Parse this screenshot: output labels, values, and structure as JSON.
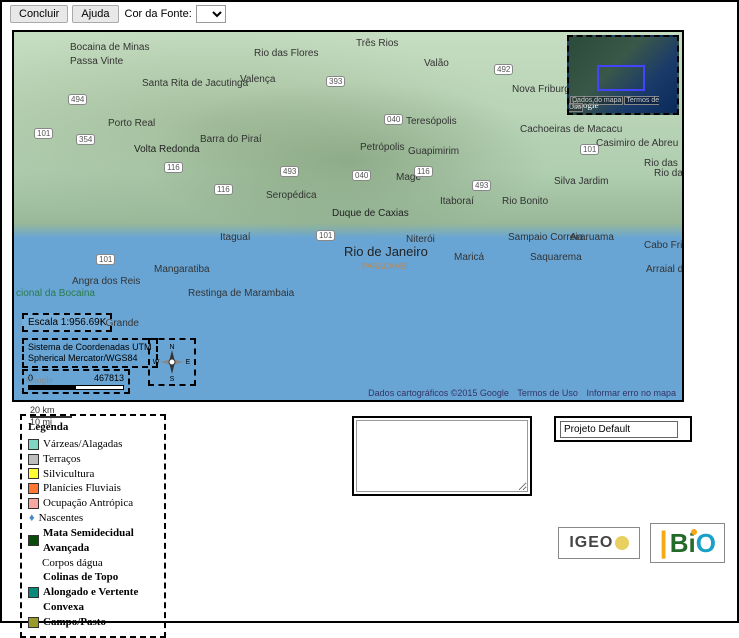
{
  "toolbar": {
    "concluir": "Concluir",
    "ajuda": "Ajuda",
    "font_color_label": "Cor da Fonte:"
  },
  "map": {
    "cities": {
      "tres_rios": "Três Rios",
      "valao": "Valão",
      "nova_friburgo": "Nova Friburgo",
      "teresopolis": "Teresópolis",
      "petropolis": "Petrópolis",
      "guapimirim": "Guapimirim",
      "mage": "Magé",
      "volta_redonda": "Volta Redonda",
      "barra_do_pirai": "Barra do Piraí",
      "porto_real": "Porto Real",
      "angra_dos_reis": "Angra dos Reis",
      "mangaratiba": "Mangaratiba",
      "restinga": "Restinga de Marambaia",
      "seropedica": "Seropédica",
      "itaguai": "Itaguaí",
      "duque_de_caxias": "Duque de Caxias",
      "rio_de_janeiro": "Rio de Janeiro",
      "niteroi": "Niterói",
      "itaborai": "Itaboraí",
      "marica": "Maricá",
      "rio_bonito": "Rio Bonito",
      "saquarema": "Saquarema",
      "araruama": "Araruama",
      "cabo_frio": "Cabo Frio",
      "arraial": "Arraial do Cabo",
      "cachoeiras": "Cachoeiras de Macacu",
      "cordeiro_abreu": "Casimiro de Abreu",
      "silva_jardim": "Silva Jardim",
      "valenca": "Valença",
      "rio_das_flores": "Rio das Flores",
      "paracambi": "PARACAMBI",
      "bocaina": "Bocaina de Minas",
      "passa_vinte": "Passa Vinte",
      "rio_das": "Rio das",
      "santa_rita": "Santa Rita de Jacutinga",
      "pq_bocaina": "cional da Bocaina",
      "sampaio": "Sampaio Correia",
      "grande": "I Grande",
      "ostras": "Rio das Ostras"
    },
    "roads": {
      "r101": "101",
      "r116": "116",
      "r040": "040",
      "r393": "393",
      "r492": "492",
      "r493": "493",
      "r494": "494",
      "r354": "354"
    },
    "minimap": {
      "logo": "Google",
      "dados": "Dados do mapa",
      "termos": "Termos de Uso"
    },
    "footer": {
      "attribution": "Dados cartográficos ©2015 Google",
      "termos": "Termos de Uso",
      "erro": "Informar erro no mapa"
    },
    "scale_text": "Escala 1:956.69K",
    "crs_line1": "Sistema de Coordenadas UTM",
    "crs_line2": "Spherical Mercator/WGS84",
    "scalebar_left": "0",
    "scalebar_right": "467813",
    "gscale_km": "20 km",
    "gscale_mi": "10 mi",
    "google_logo": "Google"
  },
  "legend": {
    "title": "Legenda",
    "items": [
      {
        "color": "#7fd6c2",
        "label": "Várzeas/Alagadas"
      },
      {
        "color": "#bdbdbd",
        "label": "Terraços"
      },
      {
        "color": "#ffff33",
        "label": "Silvicultura"
      },
      {
        "color": "#ff7733",
        "label": "Planícies Fluviais"
      },
      {
        "color": "#f7a7a0",
        "label": "Ocupação Antrópica"
      }
    ],
    "nascentes": "Nascentes",
    "mata_color": "#0a4a0a",
    "mata_label": "Mata Semidecidual Avançada",
    "corpos": "Corpos dágua",
    "colinas_color": "#0a8a7a",
    "colinas_label": "Colinas de Topo Alongado e Vertente Convexa",
    "campo_color": "#9a9a2a",
    "campo_label": "Campo/Pasto"
  },
  "project": {
    "value": "Projeto Default"
  },
  "logos": {
    "igeo": "IGEO",
    "ibio_b": "B",
    "ibio_i": "i",
    "ibio_o": "O"
  }
}
